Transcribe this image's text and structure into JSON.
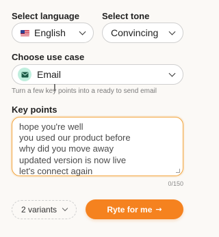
{
  "language": {
    "label": "Select language",
    "value": "English",
    "flag_icon": "us-flag-icon"
  },
  "tone": {
    "label": "Select tone",
    "value": "Convincing"
  },
  "use_case": {
    "label": "Choose use case",
    "value": "Email",
    "icon": "email-icon",
    "hint": "Turn a few key points into a ready to send email"
  },
  "key_points": {
    "label": "Key points",
    "lines": [
      "hope you're well",
      "you used our product before",
      "why did you move away",
      "updated version is now live",
      "let's connect again"
    ],
    "counter": "0/150"
  },
  "variants": {
    "value": "2 variants"
  },
  "submit": {
    "label": "Ryte for me",
    "arrow": "→"
  },
  "colors": {
    "accent": "#f5821f",
    "focus_border": "#f2a33a",
    "email_icon_bg": "#bfeedd"
  }
}
